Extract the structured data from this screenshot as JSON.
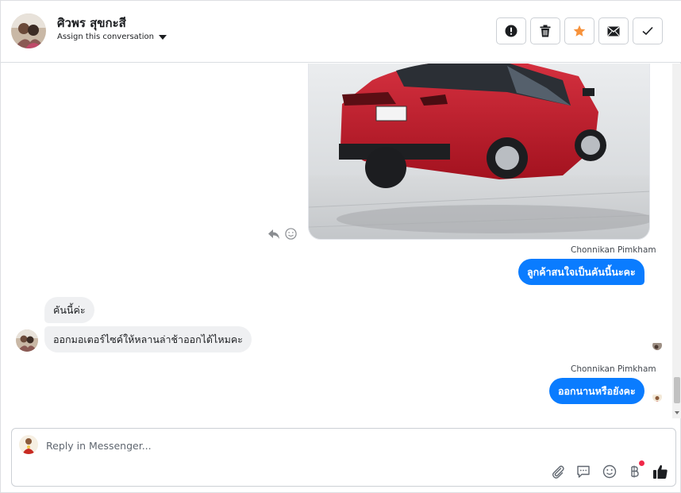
{
  "header": {
    "contact_name": "ศิวพร สุขกะสี",
    "assign_label": "Assign this conversation",
    "actions": [
      {
        "icon": "alert-icon",
        "name": "mark-spam-button"
      },
      {
        "icon": "trash-icon",
        "name": "delete-button"
      },
      {
        "icon": "star-icon",
        "name": "star-button"
      },
      {
        "icon": "envelope-icon",
        "name": "mark-unread-button"
      },
      {
        "icon": "checkmark-icon",
        "name": "mark-done-button"
      }
    ],
    "star_color": "#f7923b"
  },
  "messages": [
    {
      "id": "m1",
      "direction": "outgoing",
      "type": "image",
      "image": "red-sedan-photo"
    },
    {
      "id": "m2",
      "direction": "outgoing",
      "sender": "Chonnikan Pimkham",
      "text": "ลูกค้าสนใจเป็นคันนี้นะคะ"
    },
    {
      "id": "m3",
      "direction": "incoming",
      "text": "คันนี้ค่ะ"
    },
    {
      "id": "m4",
      "direction": "incoming",
      "text": "ออกมอเตอร์ไซค์ให้หลานล่าช้าออกได้ไหมคะ"
    },
    {
      "id": "m5",
      "direction": "outgoing",
      "sender": "Chonnikan Pimkham",
      "text": "ออกนานหรือยังคะ"
    }
  ],
  "composer": {
    "placeholder": "Reply in Messenger...",
    "value": "",
    "tools": [
      "paperclip-icon",
      "speech-bubble-icon",
      "smiley-icon",
      "baht-icon",
      "thumbs-up-icon"
    ]
  },
  "colors": {
    "outgoing_bubble": "#0a7cff",
    "incoming_bubble": "#eff0f2",
    "notification_dot": "#f02849"
  }
}
